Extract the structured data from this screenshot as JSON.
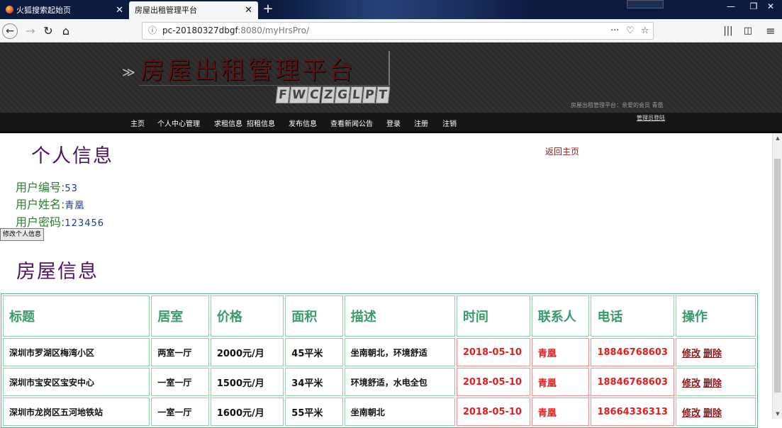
{
  "browser": {
    "tabs": [
      {
        "label": "火狐搜索起始页"
      },
      {
        "label": "房屋出租管理平台"
      }
    ],
    "url_host": "pc-20180327dbgf",
    "url_rest": ":8080/myHrsPro/",
    "more_glyph": "···"
  },
  "site": {
    "logo": "房屋出租管理平台",
    "logo_letters": [
      "F",
      "W",
      "C",
      "Z",
      "G",
      "L",
      "P",
      "T"
    ],
    "welcome": "房屋出租管理平台：亲爱的会员 青凰",
    "menu": [
      "主页",
      "个人中心管理",
      "求租信息",
      "招租信息",
      "发布信息",
      "查看新闻公告",
      "登录",
      "注册",
      "注销"
    ],
    "admin_link": "管理员登陆"
  },
  "profile": {
    "heading": "个人信息",
    "back_home": "返回主页",
    "id_label": "用户编号:",
    "id_value": "53",
    "name_label": "用户姓名:",
    "name_value": "青凰",
    "pwd_label": "用户密码:",
    "pwd_value": "123456",
    "edit_button": "修改个人信息"
  },
  "houses": {
    "heading": "房屋信息",
    "columns": [
      "标题",
      "居室",
      "价格",
      "面积",
      "描述",
      "时间",
      "联系人",
      "电话",
      "操作"
    ],
    "rows": [
      {
        "title": "深圳市罗湖区梅湾小区",
        "rooms": "两室一厅",
        "price": "2000元/月",
        "area": "45平米",
        "desc": "坐南朝北，环境舒适",
        "date": "2018-05-10",
        "contact": "青凰",
        "phone": "18846768603",
        "edit": "修改",
        "delete": "删除"
      },
      {
        "title": "深圳市宝安区宝安中心",
        "rooms": "一室一厅",
        "price": "1500元/月",
        "area": "34平米",
        "desc": "环境舒适，水电全包",
        "date": "2018-05-10",
        "contact": "青凰",
        "phone": "18846768603",
        "edit": "修改",
        "delete": "删除"
      },
      {
        "title": "深圳市龙岗区五河地铁站",
        "rooms": "一室一厅",
        "price": "1600元/月",
        "area": "55平米",
        "desc": "坐南朝北",
        "date": "2018-05-10",
        "contact": "青凰",
        "phone": "18664336313",
        "edit": "修改",
        "delete": "删除"
      }
    ]
  }
}
